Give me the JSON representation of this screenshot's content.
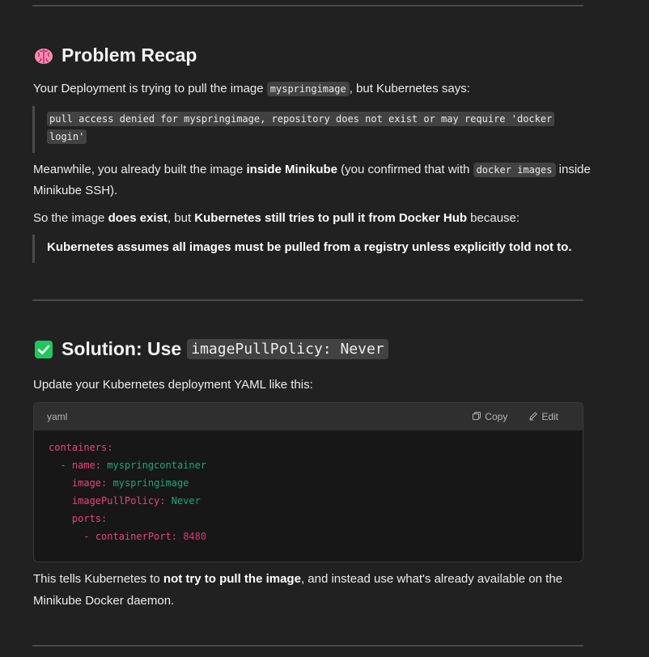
{
  "recap": {
    "heading": "Problem Recap",
    "intro_pre": "Your Deployment is trying to pull the image ",
    "intro_code": "myspringimage",
    "intro_post": ", but Kubernetes says:",
    "error_line1": "pull access denied for myspringimage, repository does not exist or may require 'docker",
    "error_line2": "login'",
    "meanwhile_pre": "Meanwhile, you already built the image ",
    "meanwhile_bold": "inside Minikube",
    "meanwhile_mid": " (you confirmed that with ",
    "meanwhile_code": "docker images",
    "meanwhile_post": " inside Minikube SSH).",
    "so_pre": "So the image ",
    "so_bold1": "does exist",
    "so_mid": ", but ",
    "so_bold2": "Kubernetes still tries to pull it from Docker Hub",
    "so_post": " because:",
    "quote": "Kubernetes assumes all images must be pulled from a registry unless explicitly told not to."
  },
  "solution": {
    "heading_text": "Solution: Use",
    "heading_code": "imagePullPolicy: Never",
    "intro": "Update your Kubernetes deployment YAML like this:",
    "code_lang": "yaml",
    "copy_label": "Copy",
    "edit_label": "Edit",
    "code": {
      "l1_key": "containers:",
      "l2_dash": "- ",
      "l2_key": "name:",
      "l2_val": " myspringcontainer",
      "l3_key": "image:",
      "l3_val": " myspringimage",
      "l4_key": "imagePullPolicy:",
      "l4_val": " Never",
      "l5_key": "ports:",
      "l6_dash": "- ",
      "l6_key": "containerPort:",
      "l6_val": " 8480"
    },
    "outro_pre": "This tells Kubernetes to ",
    "outro_bold": "not try to pull the image",
    "outro_post": ", and instead use what's already available on the Minikube Docker daemon."
  },
  "icons": {
    "recap": "brain-icon",
    "solution": "check-box-icon",
    "copy": "copy-icon",
    "edit": "edit-icon"
  },
  "colors": {
    "background": "#212121",
    "check": "#22c55e",
    "yaml_key": "#e8467c",
    "yaml_value": "#1fa67a"
  }
}
